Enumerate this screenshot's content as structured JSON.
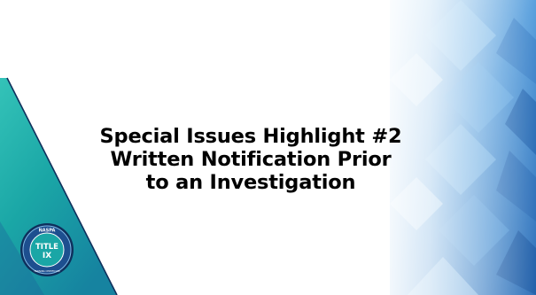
{
  "slide": {
    "title_lines": [
      "Special Issues Highlight #2",
      "Written Notification Prior",
      "to an Investigation"
    ]
  },
  "badge": {
    "logo_text_top": "NASPA",
    "logo_text_main_1": "TITLE",
    "logo_text_main_2": "IX",
    "logo_text_bottom": "TRAINING CERTIFICATE"
  },
  "colors": {
    "teal": "#1aa6a6",
    "blue": "#1d4f8f",
    "light_blue": "#7fb8e6",
    "navy": "#0e2f5c"
  }
}
